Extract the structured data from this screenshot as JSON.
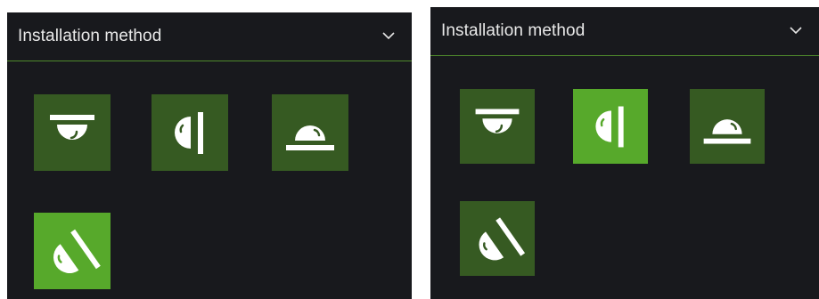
{
  "panels": [
    {
      "header": {
        "title": "Installation method",
        "chevron_icon": "chevron-down-icon"
      },
      "options": [
        {
          "icon": "ceiling-mount-icon",
          "selected": false
        },
        {
          "icon": "wall-mount-icon",
          "selected": false
        },
        {
          "icon": "floor-mount-icon",
          "selected": false
        },
        {
          "icon": "tilted-wall-mount-icon",
          "selected": true
        }
      ]
    },
    {
      "header": {
        "title": "Installation method",
        "chevron_icon": "chevron-down-icon"
      },
      "options": [
        {
          "icon": "ceiling-mount-icon",
          "selected": false
        },
        {
          "icon": "wall-mount-icon",
          "selected": true
        },
        {
          "icon": "floor-mount-icon",
          "selected": false
        },
        {
          "icon": "tilted-wall-mount-icon",
          "selected": false
        }
      ]
    }
  ],
  "colors": {
    "panel_bg": "#18191d",
    "tile_bg": "#365a22",
    "tile_selected_bg": "#57a92b",
    "divider": "#4f8b2c",
    "title_text": "#e9e9e9"
  }
}
